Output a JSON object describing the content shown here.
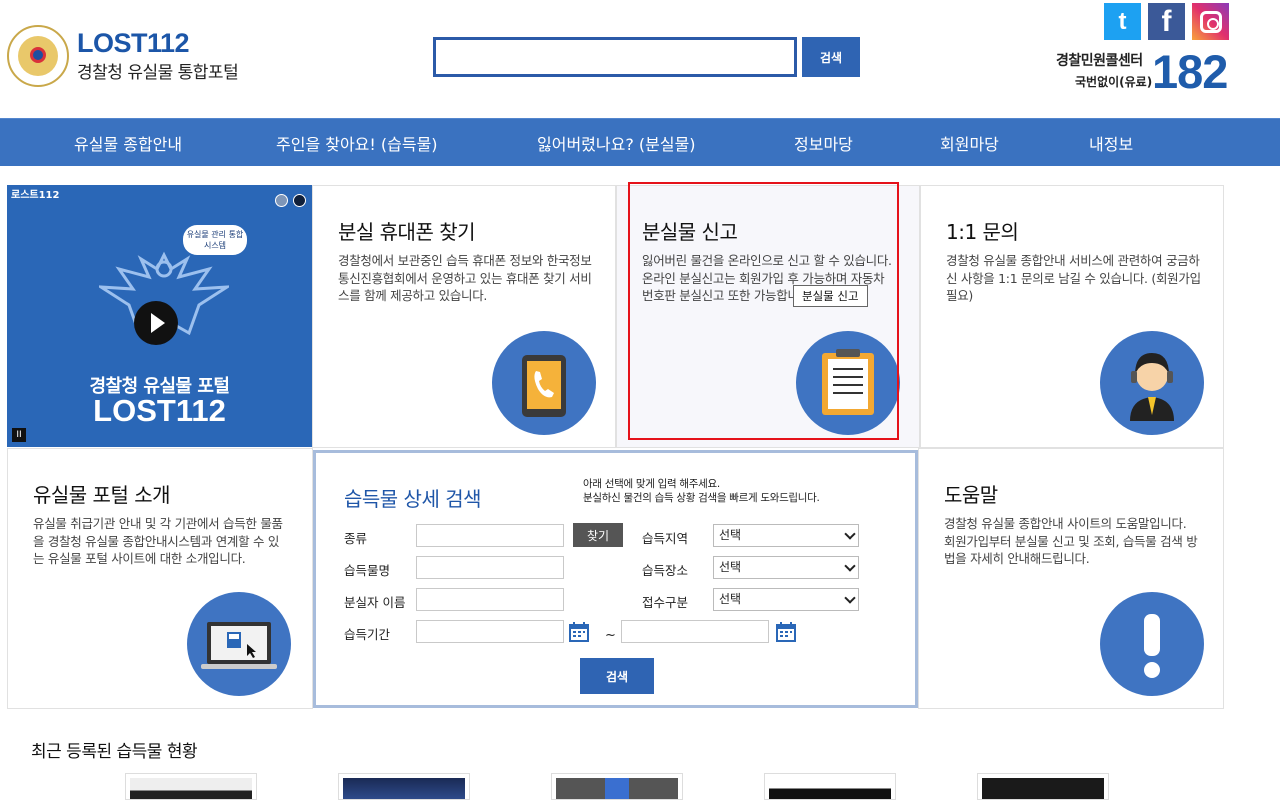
{
  "header": {
    "brand_title": "LOST112",
    "brand_sub": "경찰청 유실물 통합포털",
    "search_placeholder": "",
    "search_button": "검색",
    "sns": {
      "twitter": "t",
      "facebook": "f"
    },
    "call_label": "경찰민원콜센터",
    "call_sub": "국번없이(유료)",
    "call_number": "182"
  },
  "nav": {
    "items": [
      "유실물 종합안내",
      "주인을 찾아요! (습득물)",
      "잃어버렸나요? (분실물)",
      "정보마당",
      "회원마당",
      "내정보"
    ]
  },
  "promo": {
    "tag": "로스트112",
    "bubble": "유실물 관리 통합 시스템",
    "title_line1": "경찰청 유실물 포털",
    "title_line2": "LOST112",
    "pause": "II"
  },
  "tiles": {
    "phone": {
      "title": "분실 휴대폰 찾기",
      "desc": "경찰청에서 보관중인 습득 휴대폰 정보와 한국정보통신진흥협회에서 운영하고 있는 휴대폰 찾기 서비스를 함께 제공하고 있습니다."
    },
    "report": {
      "title": "분실물 신고",
      "desc": "잃어버린 물건을 온라인으로 신고 할 수 있습니다. 온라인 분실신고는 회원가입 후 가능하며 자동차 번호판 분실신고 또한 가능합니다.",
      "tooltip": "분실물 신고"
    },
    "qna": {
      "title": "1:1 문의",
      "desc": "경찰청 유실물 종합안내 서비스에 관련하여 궁금하신 사항을 1:1 문의로 남길 수 있습니다. (회원가입 필요)"
    },
    "intro": {
      "title": "유실물 포털 소개",
      "desc": "유실물 취급기관 안내 및 각 기관에서 습득한 물품을 경찰청 유실물 종합안내시스템과 연계할 수 있는 유실물 포털 사이트에 대한 소개입니다."
    },
    "help": {
      "title": "도움말",
      "desc": "경찰청 유실물 종합안내 사이트의 도움말입니다. 회원가입부터 분실물 신고 및 조회, 습득물 검색 방법을 자세히 안내해드립니다."
    }
  },
  "search_panel": {
    "title": "습득물 상세 검색",
    "note_line1": "아래 선택에 맞게 입력 해주세요.",
    "note_line2": "분실하신 물건의 습득 상황 검색을 빠르게 도와드립니다.",
    "labels": {
      "kind": "종류",
      "item_name": "습득물명",
      "owner_name": "분실자 이름",
      "period": "습득기간",
      "region": "습득지역",
      "place": "습득장소",
      "receipt": "접수구분"
    },
    "find_button": "찾기",
    "select_default": "선택",
    "tilde": "~",
    "submit": "검색"
  },
  "recent": {
    "title": "최근 등록된 습득물 현황"
  },
  "colors": {
    "primary": "#3a72c0",
    "brand": "#1c56a8",
    "highlight": "#e5121a"
  }
}
